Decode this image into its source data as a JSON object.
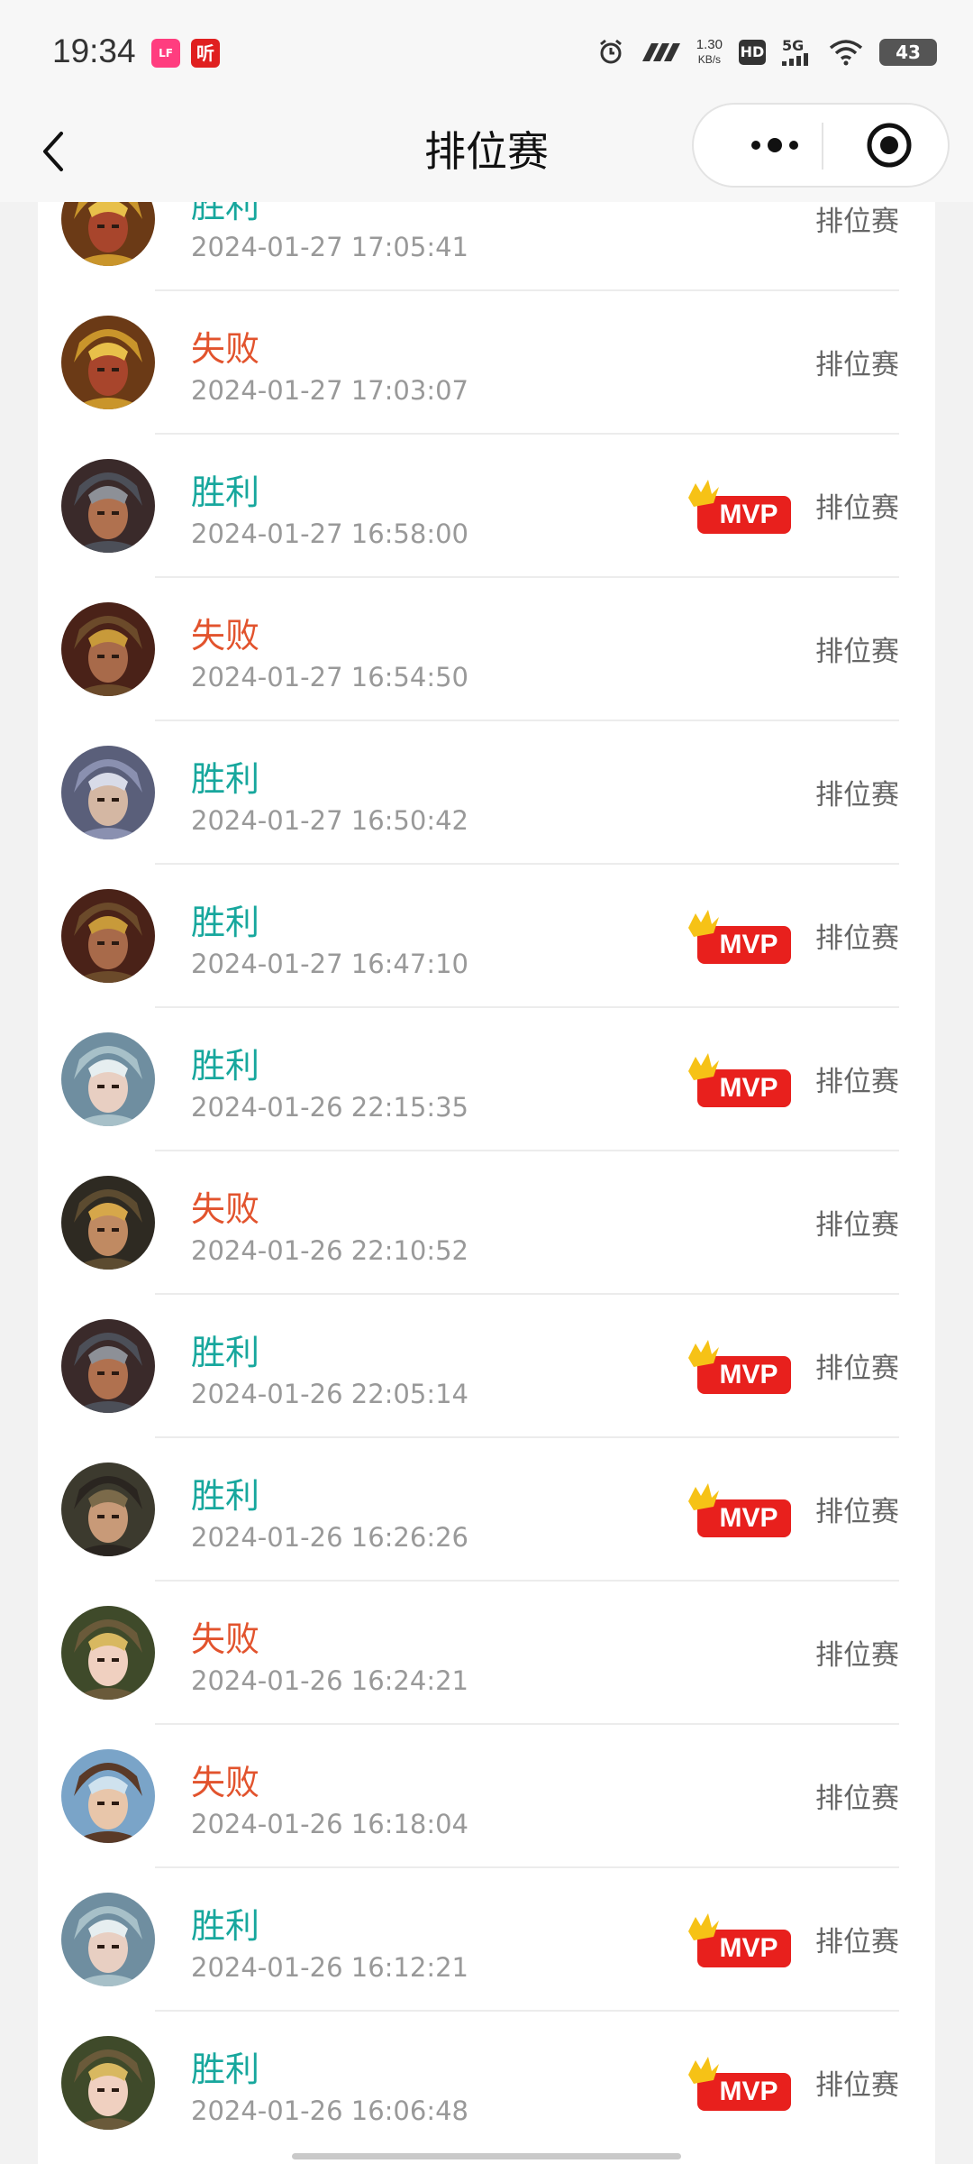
{
  "status_bar": {
    "time": "19:34",
    "app1_text": "Lofter",
    "app2_text": "听",
    "speed_value": "1.30",
    "speed_unit": "KB/s",
    "hd_label": "HD",
    "network_label": "5G",
    "battery": "43",
    "icons": [
      "alarm-icon",
      "signal-strength-icon",
      "wifi-icon",
      "battery-icon"
    ]
  },
  "navbar": {
    "title": "排位赛",
    "icons": [
      "back-chevron-icon",
      "more-dots-icon",
      "close-target-icon"
    ]
  },
  "badge": {
    "mvp_label": "MVP"
  },
  "colors": {
    "win": "#17a79d",
    "lose": "#e2532d",
    "mvp_red": "#e8201d",
    "crown_yellow": "#f6c216"
  },
  "matches": [
    {
      "result": "胜利",
      "outcome": "win",
      "time": "2024-01-27 17:05:41",
      "mvp": false,
      "mode": "排位赛",
      "avatar": "gold-warrior"
    },
    {
      "result": "失败",
      "outcome": "lose",
      "time": "2024-01-27 17:03:07",
      "mvp": false,
      "mode": "排位赛",
      "avatar": "gold-warrior"
    },
    {
      "result": "胜利",
      "outcome": "win",
      "time": "2024-01-27 16:58:00",
      "mvp": true,
      "mode": "排位赛",
      "avatar": "helmet-warrior"
    },
    {
      "result": "失败",
      "outcome": "lose",
      "time": "2024-01-27 16:54:50",
      "mvp": false,
      "mode": "排位赛",
      "avatar": "bearded-general"
    },
    {
      "result": "胜利",
      "outcome": "win",
      "time": "2024-01-27 16:50:42",
      "mvp": false,
      "mode": "排位赛",
      "avatar": "silver-knight"
    },
    {
      "result": "胜利",
      "outcome": "win",
      "time": "2024-01-27 16:47:10",
      "mvp": true,
      "mode": "排位赛",
      "avatar": "bearded-general"
    },
    {
      "result": "胜利",
      "outcome": "win",
      "time": "2024-01-26 22:15:35",
      "mvp": true,
      "mode": "排位赛",
      "avatar": "silver-hair-mage"
    },
    {
      "result": "失败",
      "outcome": "lose",
      "time": "2024-01-26 22:10:52",
      "mvp": false,
      "mode": "排位赛",
      "avatar": "laughing-dwarf"
    },
    {
      "result": "胜利",
      "outcome": "win",
      "time": "2024-01-26 22:05:14",
      "mvp": true,
      "mode": "排位赛",
      "avatar": "helmet-warrior"
    },
    {
      "result": "胜利",
      "outcome": "win",
      "time": "2024-01-26 16:26:26",
      "mvp": true,
      "mode": "排位赛",
      "avatar": "dark-hair-swordsman"
    },
    {
      "result": "失败",
      "outcome": "lose",
      "time": "2024-01-26 16:24:21",
      "mvp": false,
      "mode": "排位赛",
      "avatar": "crowned-lady"
    },
    {
      "result": "失败",
      "outcome": "lose",
      "time": "2024-01-26 16:18:04",
      "mvp": false,
      "mode": "排位赛",
      "avatar": "young-boy"
    },
    {
      "result": "胜利",
      "outcome": "win",
      "time": "2024-01-26 16:12:21",
      "mvp": true,
      "mode": "排位赛",
      "avatar": "silver-hair-mage"
    },
    {
      "result": "胜利",
      "outcome": "win",
      "time": "2024-01-26 16:06:48",
      "mvp": true,
      "mode": "排位赛",
      "avatar": "crowned-lady"
    }
  ]
}
